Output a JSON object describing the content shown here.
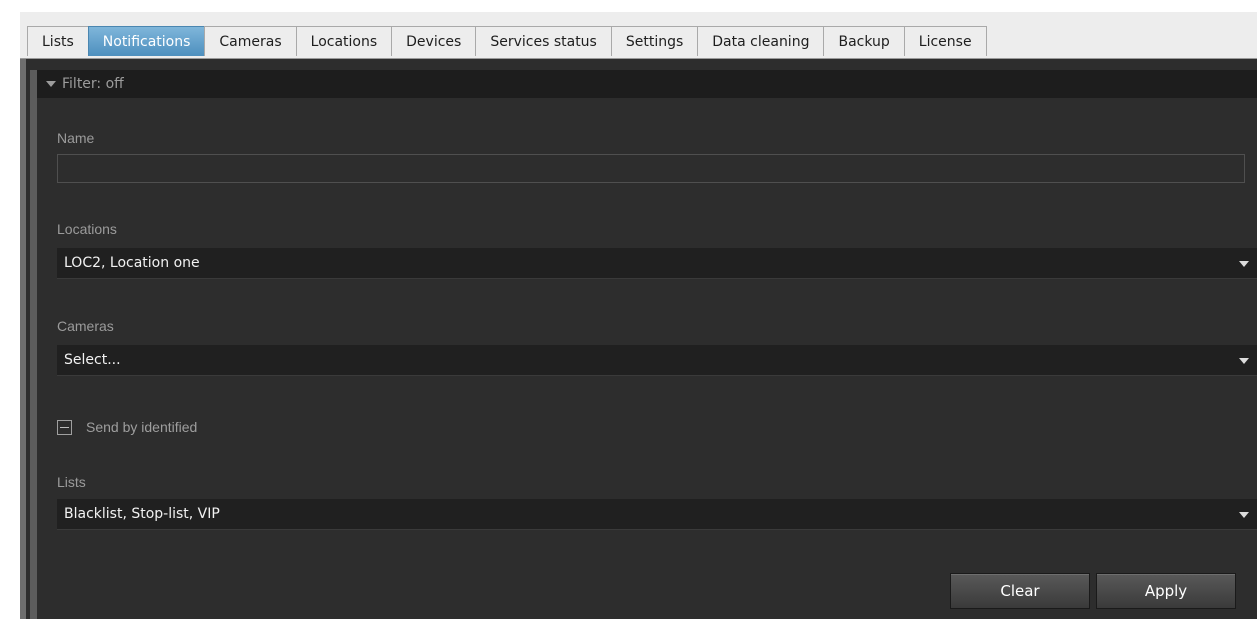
{
  "tabs": [
    {
      "label": "Lists",
      "active": false
    },
    {
      "label": "Notifications",
      "active": true
    },
    {
      "label": "Cameras",
      "active": false
    },
    {
      "label": "Locations",
      "active": false
    },
    {
      "label": "Devices",
      "active": false
    },
    {
      "label": "Services status",
      "active": false
    },
    {
      "label": "Settings",
      "active": false
    },
    {
      "label": "Data cleaning",
      "active": false
    },
    {
      "label": "Backup",
      "active": false
    },
    {
      "label": "License",
      "active": false
    }
  ],
  "filter": {
    "header_label": "Filter: off"
  },
  "form": {
    "name": {
      "label": "Name",
      "value": ""
    },
    "locations": {
      "label": "Locations",
      "value": "LOC2, Location one"
    },
    "cameras": {
      "label": "Cameras",
      "value": "Select..."
    },
    "send_by_identified": {
      "label": "Send by identified",
      "state": "indeterminate"
    },
    "lists": {
      "label": "Lists",
      "value": "Blacklist, Stop-list, VIP"
    }
  },
  "buttons": {
    "clear_label": "Clear",
    "apply_label": "Apply"
  },
  "colors": {
    "panel_background": "#2d2d2d",
    "active_tab": "#5e9fcb",
    "select_background": "#202020"
  }
}
